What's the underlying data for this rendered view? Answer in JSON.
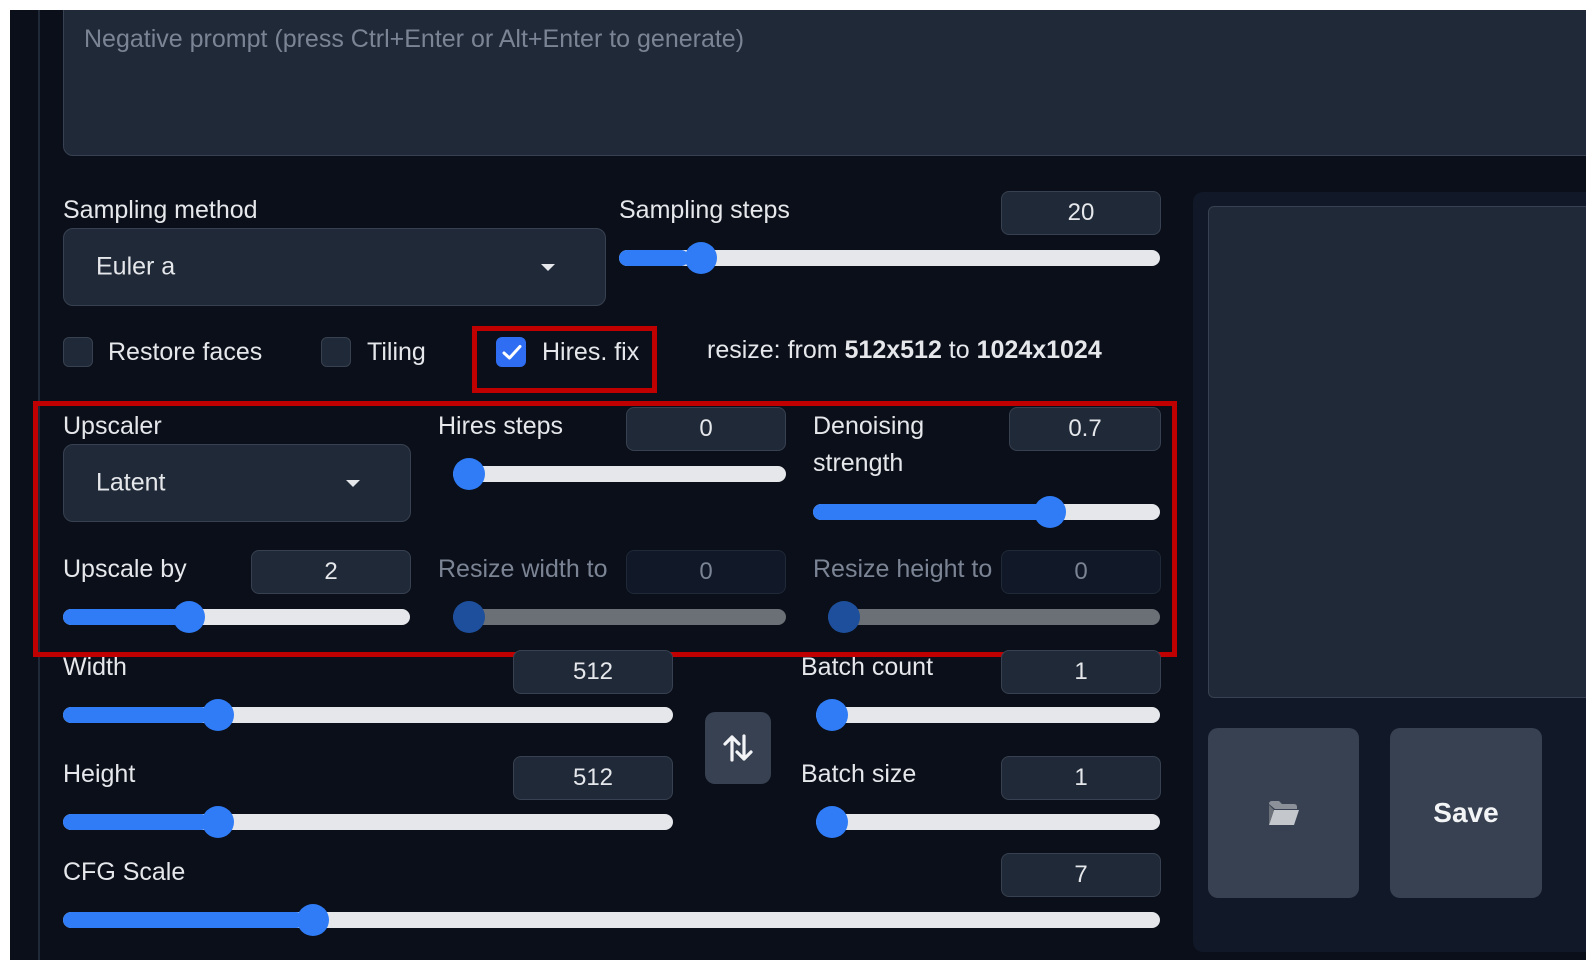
{
  "prompt": {
    "negative_placeholder": "Negative prompt (press Ctrl+Enter or Alt+Enter to generate)"
  },
  "sampling": {
    "method_label": "Sampling method",
    "method_value": "Euler a",
    "steps_label": "Sampling steps",
    "steps_value": "20",
    "steps_fraction": 0.13
  },
  "options": {
    "restore_faces": {
      "label": "Restore faces",
      "checked": false
    },
    "tiling": {
      "label": "Tiling",
      "checked": false
    },
    "hires_fix": {
      "label": "Hires. fix",
      "checked": true
    },
    "resize_prefix": "resize: from ",
    "resize_from": "512x512",
    "resize_mid": " to ",
    "resize_to": "1024x1024"
  },
  "hires": {
    "upscaler_label": "Upscaler",
    "upscaler_value": "Latent",
    "steps_label": "Hires steps",
    "steps_value": "0",
    "steps_fraction": 0.0,
    "denoise_label_1": "Denoising",
    "denoise_label_2": "strength",
    "denoise_value": "0.7",
    "denoise_fraction": 0.7,
    "upscale_by_label": "Upscale by",
    "upscale_by_value": "2",
    "upscale_by_fraction": 0.35,
    "resize_width_label": "Resize width to",
    "resize_width_value": "0",
    "resize_width_fraction": 0.0,
    "resize_height_label": "Resize height to",
    "resize_height_value": "0",
    "resize_height_fraction": 0.0
  },
  "dimensions": {
    "width_label": "Width",
    "width_value": "512",
    "width_fraction": 0.24,
    "height_label": "Height",
    "height_value": "512",
    "height_fraction": 0.24,
    "batch_count_label": "Batch count",
    "batch_count_value": "1",
    "batch_count_fraction": 0.0,
    "batch_size_label": "Batch size",
    "batch_size_value": "1",
    "batch_size_fraction": 0.0
  },
  "cfg": {
    "label": "CFG Scale",
    "value": "7",
    "fraction": 0.22
  },
  "output": {
    "save_label": "Save"
  },
  "icons": {
    "swap": "swap-dimensions-icon",
    "folder": "folder-icon",
    "dropdown": "chevron-down-icon",
    "check": "check-icon"
  },
  "colors": {
    "accent": "#2f7cf6",
    "highlight_box": "#c00000",
    "background": "#0b0f19"
  }
}
